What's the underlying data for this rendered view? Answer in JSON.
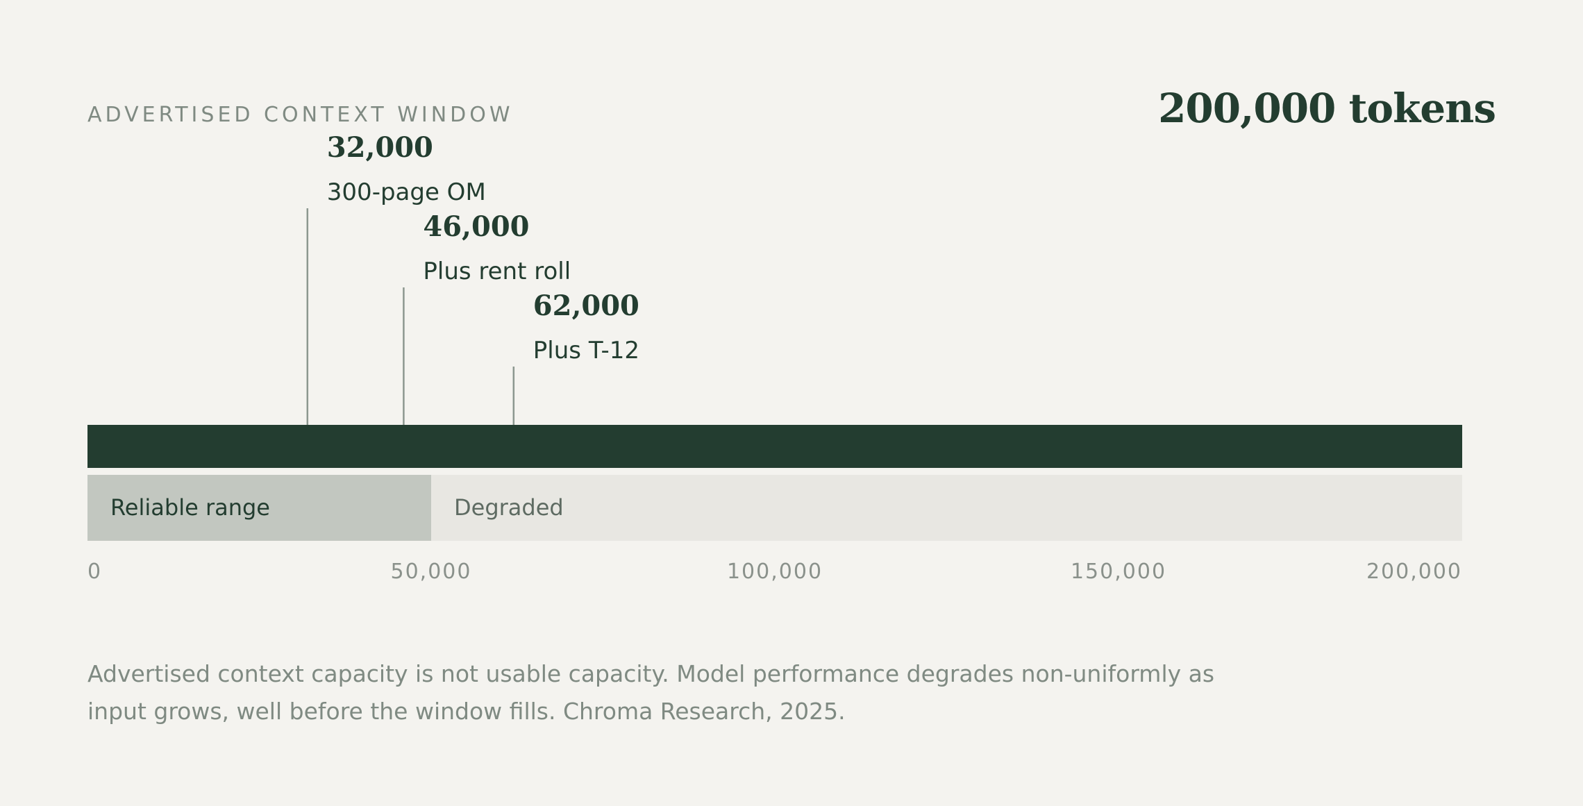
{
  "header": {
    "kicker": "ADVERTISED CONTEXT WINDOW",
    "capacity": "200,000 tokens"
  },
  "chart_data": {
    "type": "bar",
    "xlim": [
      0,
      200000
    ],
    "window_tokens": 200000,
    "colors": {
      "bar": "#233d30",
      "reliable": "#c2c7c0",
      "degraded": "#e8e7e2",
      "marker_line": "#8c978f",
      "axis_text": "#8a918b",
      "label_dark": "#233d30"
    },
    "markers": [
      {
        "value": 32000,
        "value_label": "32,000",
        "label": "300-page OM"
      },
      {
        "value": 46000,
        "value_label": "46,000",
        "label": "Plus rent roll"
      },
      {
        "value": 62000,
        "value_label": "62,000",
        "label": "Plus T-12"
      }
    ],
    "ranges": [
      {
        "label": "Reliable range",
        "from": 0,
        "to": 50000
      },
      {
        "label": "Degraded",
        "from": 50000,
        "to": 200000
      }
    ],
    "ticks": [
      {
        "value": 0,
        "label": "0"
      },
      {
        "value": 50000,
        "label": "50,000"
      },
      {
        "value": 100000,
        "label": "100,000"
      },
      {
        "value": 150000,
        "label": "150,000"
      },
      {
        "value": 200000,
        "label": "200,000"
      }
    ]
  },
  "footnote": "Advertised context capacity is not usable capacity. Model performance degrades non-uniformly as input grows, well before the window fills. Chroma Research, 2025."
}
